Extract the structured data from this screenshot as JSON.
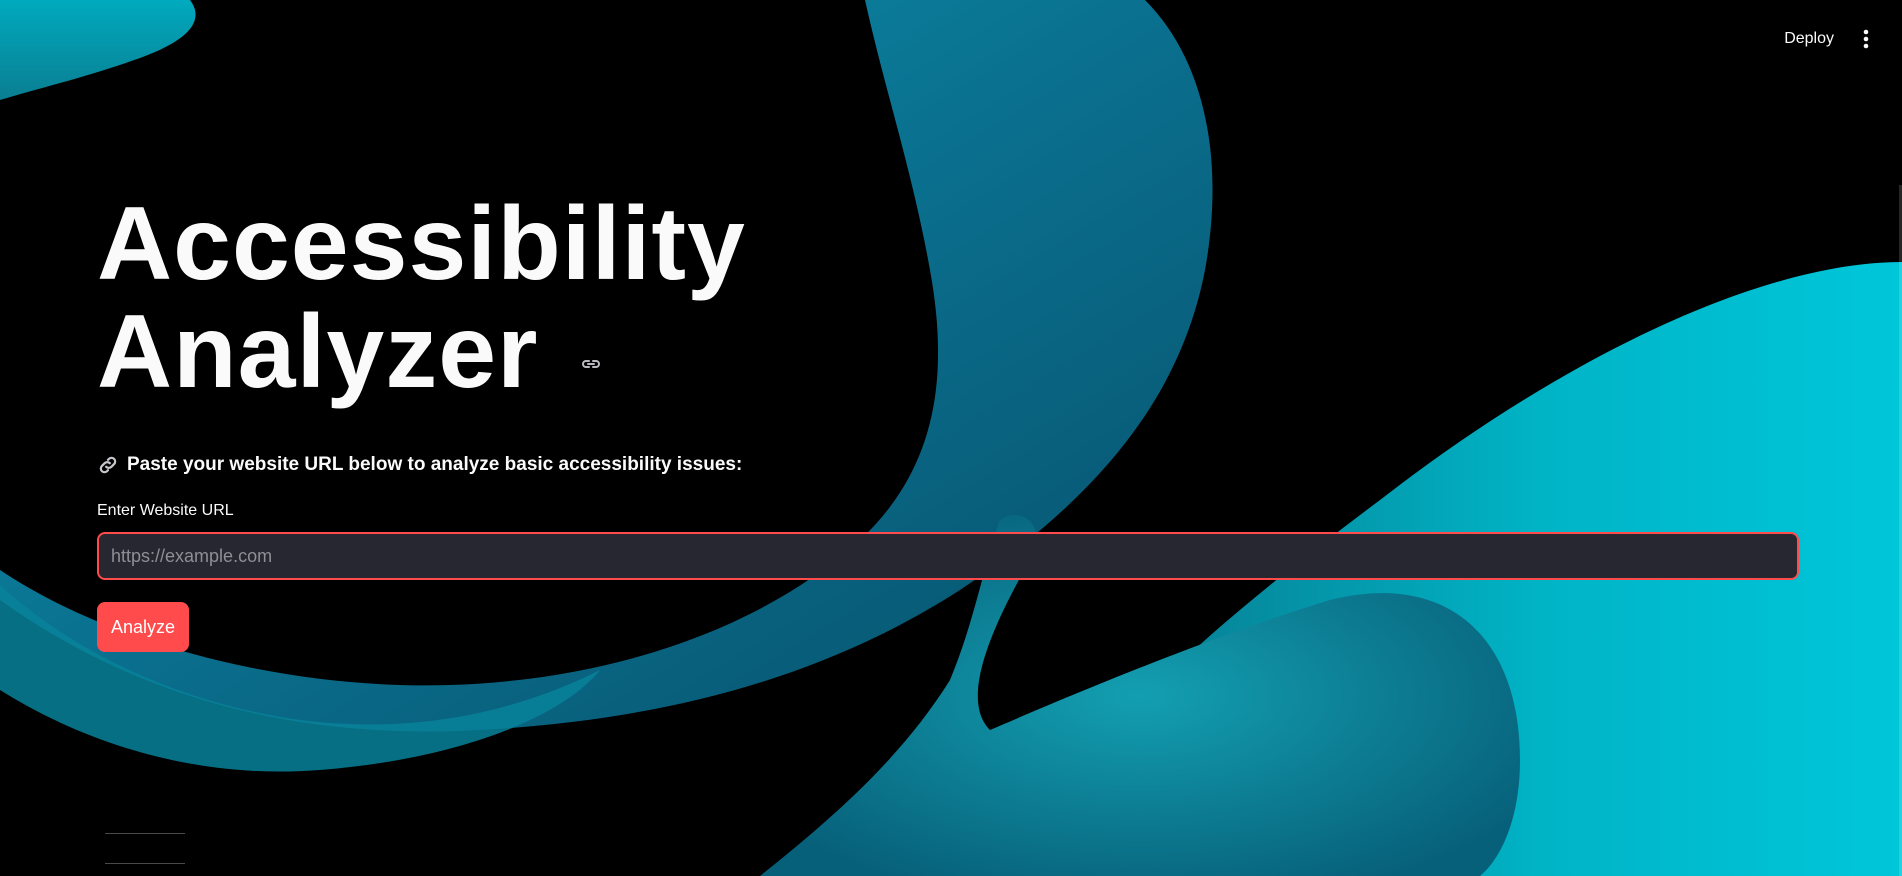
{
  "toolbar": {
    "deploy_label": "Deploy",
    "menu_icon": "vertical-ellipsis-icon"
  },
  "header": {
    "title_line1": "Accessibility",
    "title_line2": "Analyzer",
    "anchor_icon": "link-icon"
  },
  "main": {
    "intro_icon": "link-emoji-icon",
    "intro_text": "Paste your website URL below to analyze basic accessibility issues:",
    "url_label": "Enter Website URL",
    "url_value": "",
    "url_placeholder": "https://example.com",
    "analyze_label": "Analyze"
  },
  "colors": {
    "primary": "#ff4b4b",
    "input_bg": "#262730",
    "text": "#fafafa",
    "background": "#000000",
    "accent_teal": "#00b8c8"
  }
}
